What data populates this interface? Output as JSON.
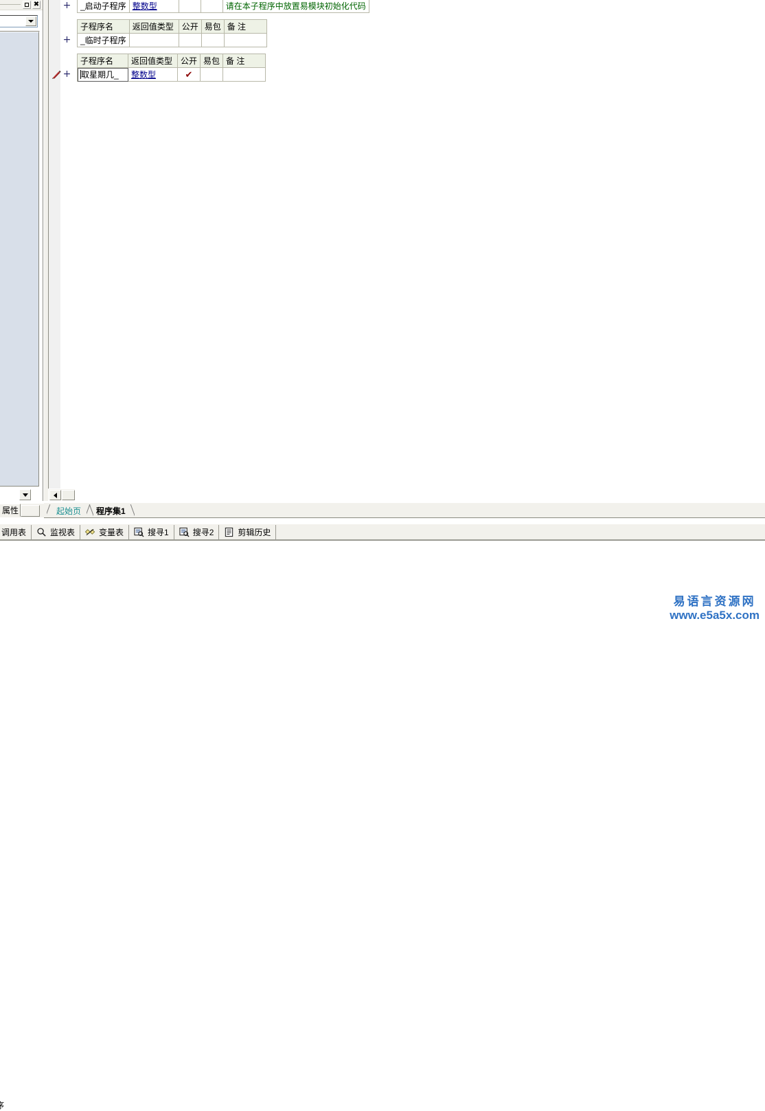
{
  "window": {
    "restore_label": "□",
    "close_label": "✕"
  },
  "left_dock": {
    "properties_tab_label": "属性",
    "combo_value": "",
    "scroll_down_icon": "triangle-down-icon"
  },
  "editor": {
    "expander_label": "+",
    "pencil_icon": "pencil-edit-icon",
    "columns": [
      "子程序名",
      "返回值类型",
      "公开",
      "易包",
      "备 注"
    ],
    "tables": [
      {
        "has_header": false,
        "rows": [
          {
            "name": "_启动子程序",
            "type": "整数型",
            "public": "",
            "pack": "",
            "note": "请在本子程序中放置易模块初始化代码",
            "editing": false
          }
        ]
      },
      {
        "has_header": true,
        "rows": [
          {
            "name": "_临时子程序",
            "type": "",
            "public": "",
            "pack": "",
            "note": "",
            "editing": false
          }
        ]
      },
      {
        "has_header": true,
        "rows": [
          {
            "name": "取星期几_",
            "type": "整数型",
            "public": "✔",
            "pack": "",
            "note": "",
            "editing": true
          }
        ]
      }
    ]
  },
  "doc_tabs": {
    "items": [
      {
        "label": "起始页",
        "active": false
      },
      {
        "label": "程序集1",
        "active": true
      }
    ]
  },
  "hscroll": {
    "left_arrow_icon": "triangle-left-icon"
  },
  "tool_tabs": {
    "items": [
      {
        "label": "调用表",
        "icon": "none"
      },
      {
        "label": "监视表",
        "icon": "magnifier-icon"
      },
      {
        "label": "变量表",
        "icon": "diamonds-icon"
      },
      {
        "label": "搜寻1",
        "icon": "search-list-icon"
      },
      {
        "label": "搜寻2",
        "icon": "search-list-icon"
      },
      {
        "label": "剪辑历史",
        "icon": "clipboard-icon"
      }
    ]
  },
  "bottom_pane": {
    "clipped_text": "序"
  },
  "watermark": {
    "cn": "易语言资源网",
    "url": "www.e5a5x.com",
    "color": "#2f72c4"
  },
  "colors": {
    "type_link": "#00008b",
    "note_green": "#006400",
    "check_red": "#8b0000",
    "header_bg": "#eef2e6",
    "chrome_bg": "#f2f1ec",
    "listbox_bg": "#d8dfe9",
    "tab_inactive_text": "#1a8f91"
  }
}
